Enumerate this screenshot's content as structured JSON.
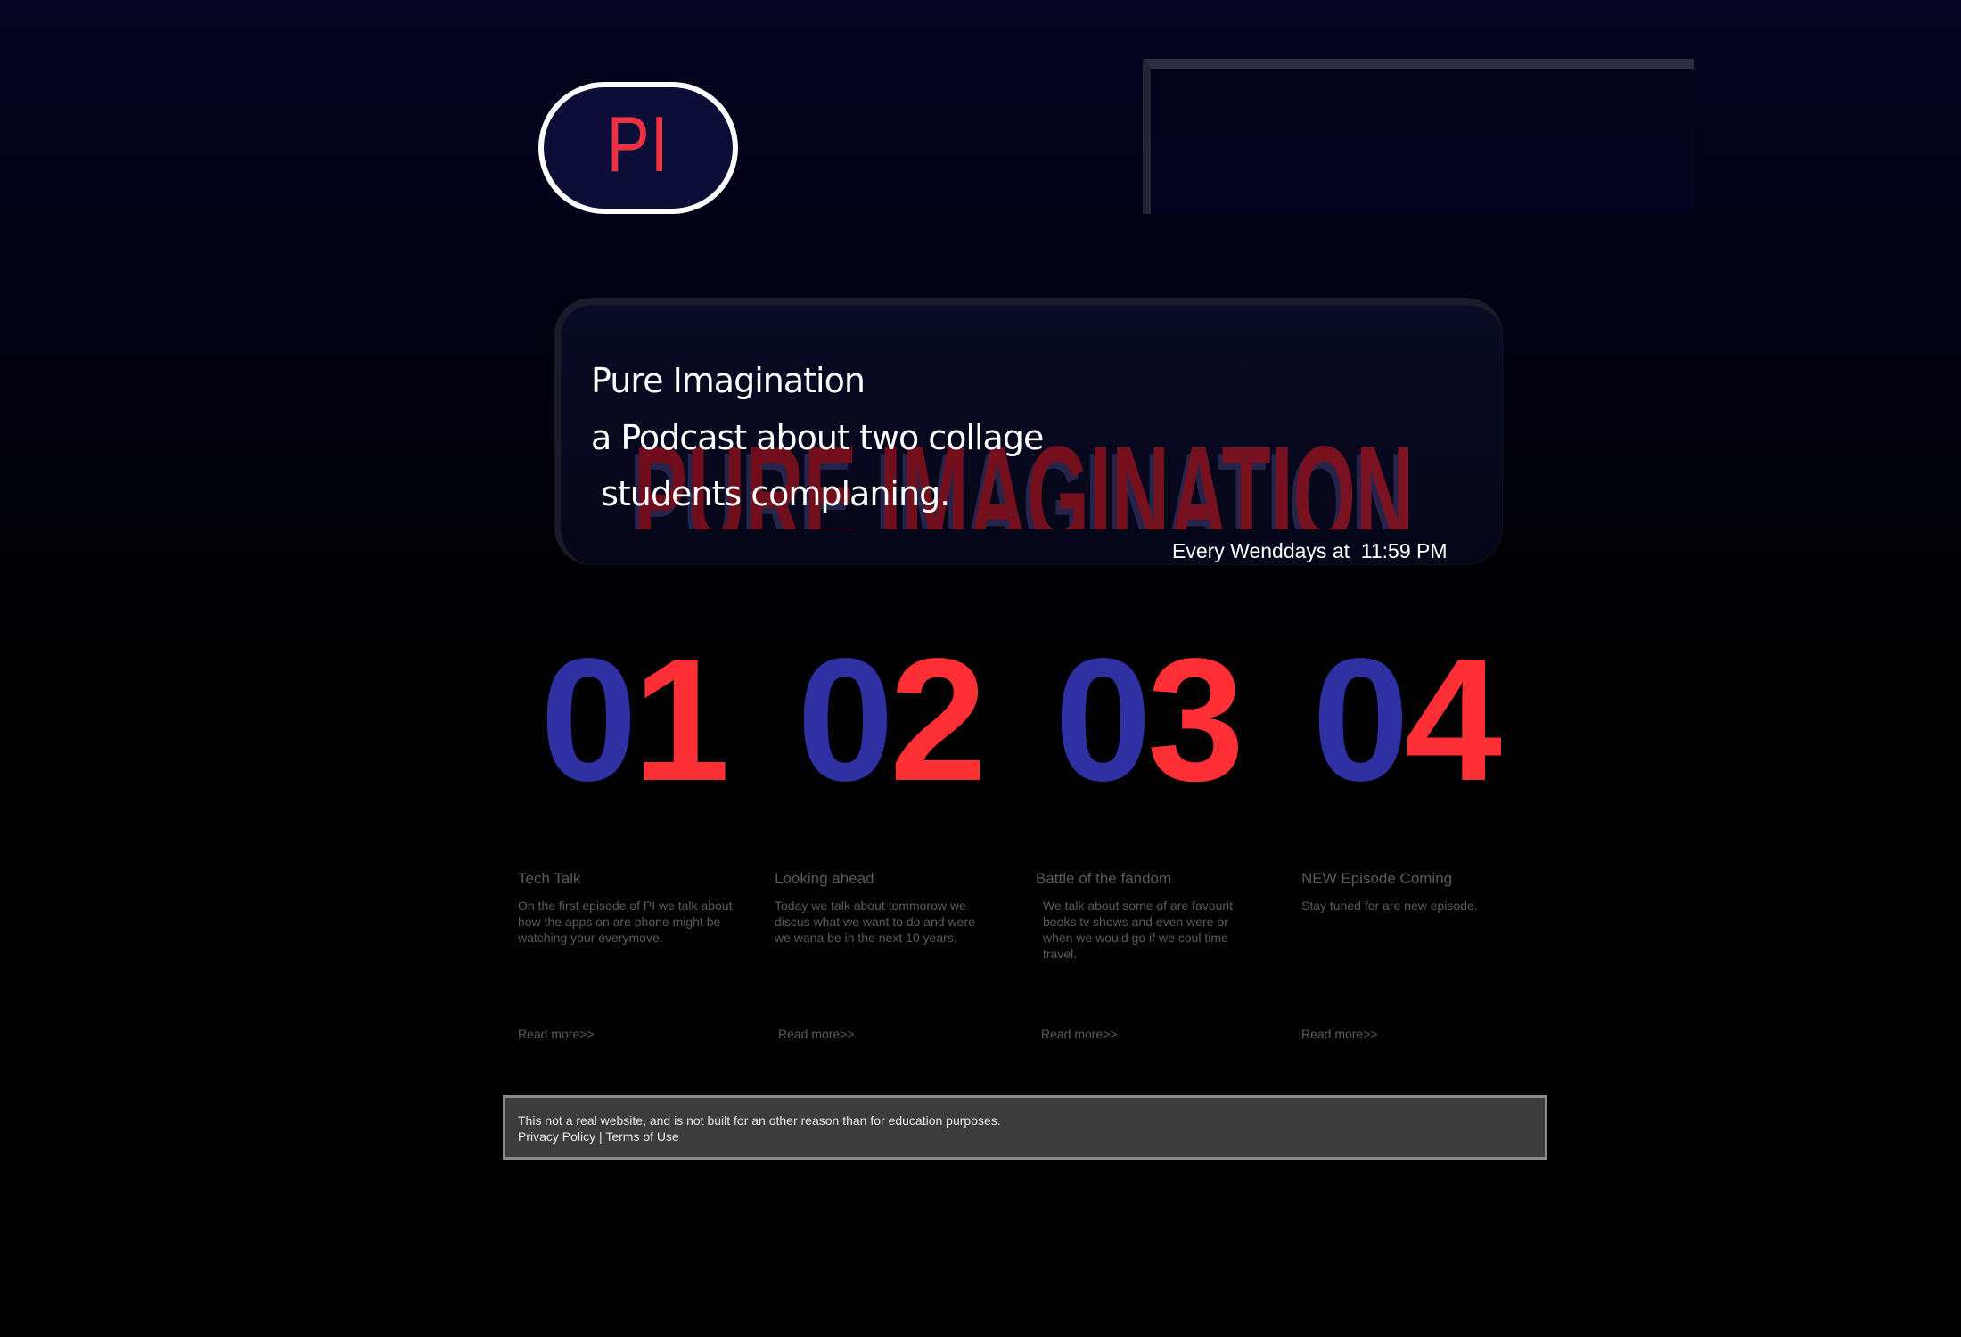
{
  "branding": {
    "logo_text": "PI",
    "hero_watermark": "PURE IMAGINATION"
  },
  "hero": {
    "line_1": "Pure Imagination",
    "line_2": "a Podcast about two collage",
    "line_3": " students complaning.",
    "schedule": "Every Wenddays at  11:59 PM"
  },
  "episodes": [
    {
      "number_prefix": "0",
      "number_suffix": "1",
      "title": "Tech Talk",
      "description": "On the first episode of PI we talk about how the apps on are phone might be watching your everymove.",
      "link": "Read more>>"
    },
    {
      "number_prefix": "0",
      "number_suffix": "2",
      "title": "Looking ahead",
      "description": "Today we talk about tommorow we discus what we want to do and were we wana be in the next 10 years.",
      "link": "Read more>>"
    },
    {
      "number_prefix": "0",
      "number_suffix": "3",
      "title": "Battle of the fandom",
      "description": "We talk about some of are favourit books tv shows and even were or when we would go if we coul time travel.",
      "link": "Read more>>"
    },
    {
      "number_prefix": "0",
      "number_suffix": "4",
      "title": "NEW Episode Coming",
      "description": "Stay tuned for are new episode.",
      "link": "Read more>>"
    }
  ],
  "footer": {
    "notice": "This not a real website, and is not built for an other reason than for education purposes.",
    "privacy_policy": "Privacy Policy",
    "separator": " | ",
    "terms": "Terms of Use"
  },
  "colors": {
    "accent_red": "#ff3035",
    "accent_blue": "#2f31a3",
    "logo_red": "#ed3142",
    "muted_text": "#5b5b5b",
    "footer_background": "#3c3c3c"
  }
}
